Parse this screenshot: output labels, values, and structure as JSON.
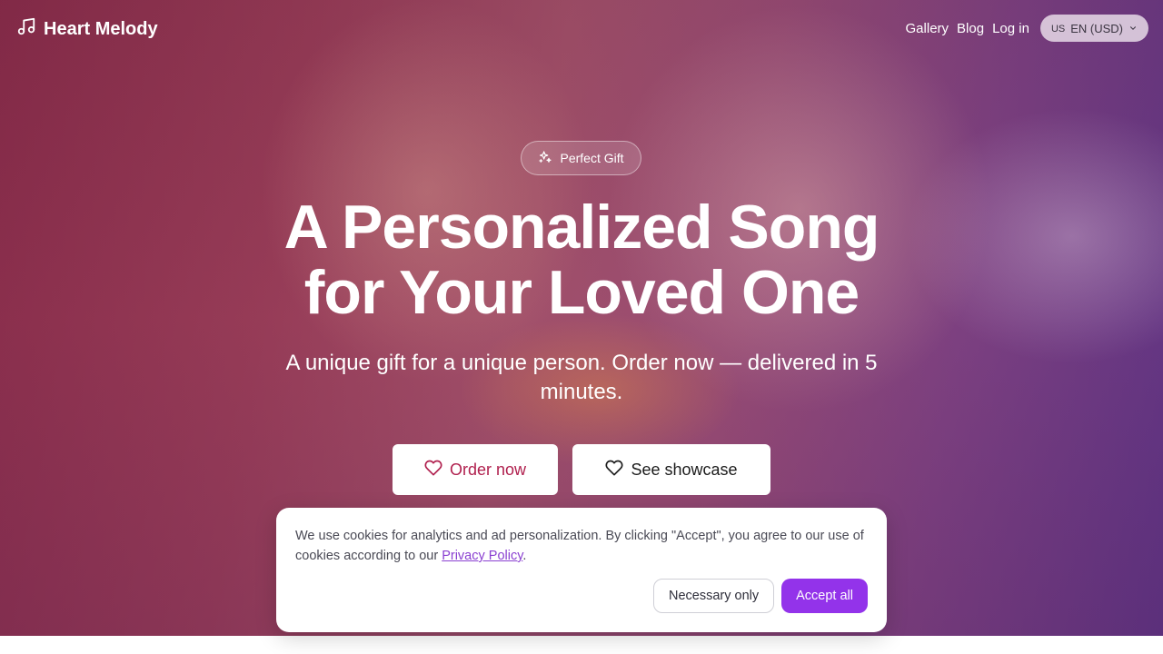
{
  "brand": {
    "name": "Heart Melody",
    "icon": "music-note-icon"
  },
  "nav": {
    "links": [
      "Gallery",
      "Blog",
      "Log in"
    ],
    "language": {
      "flag": "US",
      "label": "EN (USD)"
    }
  },
  "hero": {
    "badge": "Perfect Gift",
    "title_line1": "A Personalized Song",
    "title_line2": "for Your Loved One",
    "subtitle": "A unique gift for a unique person. Order now — delivered in 5 minutes.",
    "cta_primary": "Order now",
    "cta_secondary": "See showcase"
  },
  "cookie": {
    "text_before": "We use cookies for analytics and ad personalization. By clicking \"Accept\", you agree to our use of cookies according to our ",
    "link": "Privacy Policy",
    "text_after": ".",
    "necessary": "Necessary only",
    "accept": "Accept all"
  },
  "colors": {
    "accent": "#9333ea",
    "order_text": "#b0204e",
    "link": "#8a3fd1"
  }
}
